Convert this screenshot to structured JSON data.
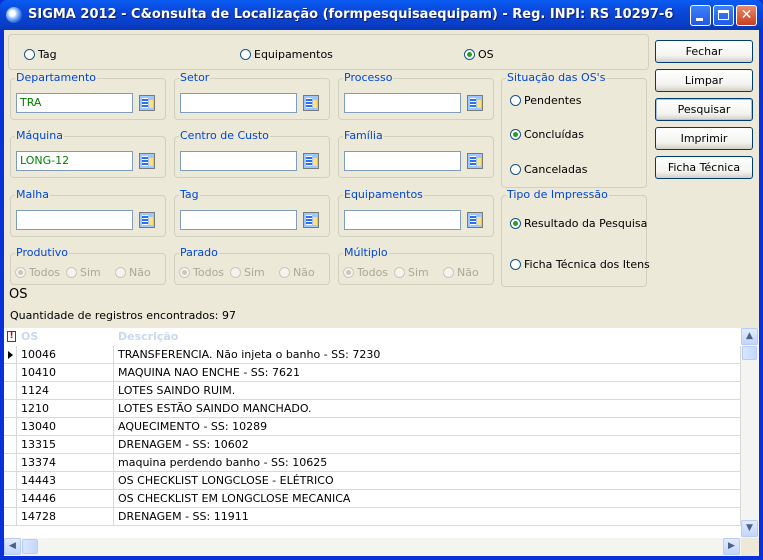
{
  "window": {
    "title": "SIGMA 2012 - C&onsulta de Localização  (formpesquisaequipam)  - Reg. INPI: RS 10297-6"
  },
  "mode": {
    "options": [
      {
        "label": "Tag",
        "selected": false
      },
      {
        "label": "Equipamentos",
        "selected": false
      },
      {
        "label": "OS",
        "selected": true
      }
    ]
  },
  "fields": {
    "departamento": {
      "label": "Departamento",
      "value": "TRA"
    },
    "setor": {
      "label": "Setor",
      "value": ""
    },
    "processo": {
      "label": "Processo",
      "value": ""
    },
    "maquina": {
      "label": "Máquina",
      "value": "LONG-12"
    },
    "centro_custo": {
      "label": "Centro de Custo",
      "value": ""
    },
    "familia": {
      "label": "Família",
      "value": ""
    },
    "malha": {
      "label": "Malha",
      "value": ""
    },
    "tag": {
      "label": "Tag",
      "value": ""
    },
    "equipamentos": {
      "label": "Equipamentos",
      "value": ""
    }
  },
  "situacao": {
    "label": "Situação das OS's",
    "options": [
      {
        "label": "Pendentes",
        "selected": false
      },
      {
        "label": "Concluídas",
        "selected": true
      },
      {
        "label": "Canceladas",
        "selected": false
      }
    ]
  },
  "tipo_impressao": {
    "label": "Tipo de Impressão",
    "options": [
      {
        "label": "Resultado da Pesquisa",
        "selected": true
      },
      {
        "label": "Ficha Técnica dos Itens",
        "selected": false
      }
    ]
  },
  "filters": {
    "produtivo": {
      "label": "Produtivo",
      "options": [
        "Todos",
        "Sim",
        "Não"
      ]
    },
    "parado": {
      "label": "Parado",
      "options": [
        "Todos",
        "Sim",
        "Não"
      ]
    },
    "multiplo": {
      "label": "Múltiplo",
      "options": [
        "Todos",
        "Sim",
        "Não"
      ]
    }
  },
  "buttons": {
    "fechar": "Fechar",
    "limpar": "Limpar",
    "pesquisar": "Pesquisar",
    "imprimir": "Imprimir",
    "ficha_tecnica": "Ficha Técnica"
  },
  "result": {
    "type_label": "OS",
    "count_text": "Quantidade de registros encontrados: 97"
  },
  "grid": {
    "warn_glyph": "!",
    "columns": [
      "OS",
      "Descrição"
    ],
    "rows": [
      {
        "os": "10046",
        "desc": "TRANSFERENCIA.  Não  injeta  o banho - SS: 7230"
      },
      {
        "os": "10410",
        "desc": "MAQUINA NAO ENCHE - SS: 7621"
      },
      {
        "os": "1124",
        "desc": "LOTES SAINDO RUIM."
      },
      {
        "os": "1210",
        "desc": "LOTES ESTÃO SAINDO MANCHADO."
      },
      {
        "os": "13040",
        "desc": "AQUECIMENTO - SS: 10289"
      },
      {
        "os": "13315",
        "desc": "DRENAGEM - SS: 10602"
      },
      {
        "os": "13374",
        "desc": "maquina perdendo banho - SS: 10625"
      },
      {
        "os": "14443",
        "desc": "OS CHECKLIST LONGCLOSE - ELÉTRICO"
      },
      {
        "os": "14446",
        "desc": "OS CHECKLIST EM LONGCLOSE MECANICA"
      },
      {
        "os": "14728",
        "desc": "DRENAGEM - SS: 11911"
      }
    ]
  }
}
